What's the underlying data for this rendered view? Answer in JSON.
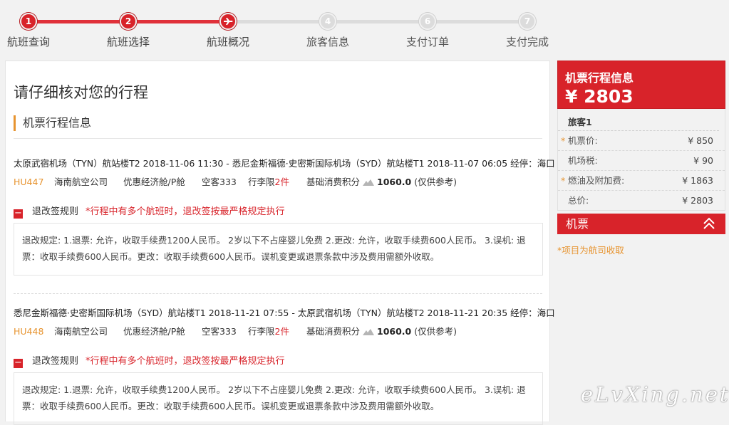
{
  "steps": [
    {
      "num": "1",
      "label": "航班查询",
      "state": "done"
    },
    {
      "num": "2",
      "label": "航班选择",
      "state": "done"
    },
    {
      "num": "",
      "label": "航班概况",
      "state": "current",
      "icon": "plane-icon"
    },
    {
      "num": "4",
      "label": "旅客信息",
      "state": "todo"
    },
    {
      "num": "6",
      "label": "支付订单",
      "state": "todo"
    },
    {
      "num": "7",
      "label": "支付完成",
      "state": "todo"
    }
  ],
  "main": {
    "title": "请仔细核对您的行程",
    "section_title": "机票行程信息",
    "segments": [
      {
        "route": "太原武宿机场（TYN）航站楼T2 2018-11-06 11:30 - 悉尼金斯福德·史密斯国际机场（SYD）航站楼T1 2018-11-07 06:05  经停：海口",
        "flight_no": "HU447",
        "airline": "海南航空公司",
        "cabin": "优惠经济舱/P舱",
        "aircraft": "空客333",
        "baggage_label": "行李限",
        "baggage_value": "2件",
        "points_label": "基础消费积分",
        "points_value": "1060.0",
        "points_note": "(仅供参考)",
        "rule_title": "退改签规则",
        "rule_note": "*行程中有多个航班时，退改签按最严格规定执行",
        "rule_text": "退改规定: 1.退票: 允许，收取手续费1200人民币。 2岁以下不占座婴儿免费 2.更改: 允许，收取手续费600人民币。 3.误机: 退票：收取手续费600人民币。更改：收取手续费600人民币。误机变更或退票条款中涉及费用需额外收取。"
      },
      {
        "route": "悉尼金斯福德·史密斯国际机场（SYD）航站楼T1 2018-11-21 07:55 - 太原武宿机场（TYN）航站楼T2 2018-11-21 20:35  经停：海口",
        "flight_no": "HU448",
        "airline": "海南航空公司",
        "cabin": "优惠经济舱/P舱",
        "aircraft": "空客333",
        "baggage_label": "行李限",
        "baggage_value": "2件",
        "points_label": "基础消费积分",
        "points_value": "1060.0",
        "points_note": "(仅供参考)",
        "rule_title": "退改签规则",
        "rule_note": "*行程中有多个航班时，退改签按最严格规定执行",
        "rule_text": "退改规定: 1.退票: 允许，收取手续费1200人民币。 2岁以下不占座婴儿免费 2.更改: 允许，收取手续费600人民币。 3.误机: 退票：收取手续费600人民币。更改：收取手续费600人民币。误机变更或退票条款中涉及费用需额外收取。"
      }
    ]
  },
  "side": {
    "title": "机票行程信息",
    "total_price": "¥ 2803",
    "passenger": "旅客1",
    "fees": [
      {
        "label": "机票价:",
        "value": "¥ 850",
        "star": "*"
      },
      {
        "label": "机场税:",
        "value": "¥ 90",
        "star": ""
      },
      {
        "label": "燃油及附加费:",
        "value": "¥ 1863",
        "star": "*"
      },
      {
        "label": "总价:",
        "value": "¥ 2803",
        "star": ""
      }
    ],
    "ticket_label": "机票",
    "note": "*项目为航司收取"
  },
  "watermark": "eLvXing.net",
  "colors": {
    "brand_red": "#d8232a",
    "accent_orange": "#e79430"
  }
}
